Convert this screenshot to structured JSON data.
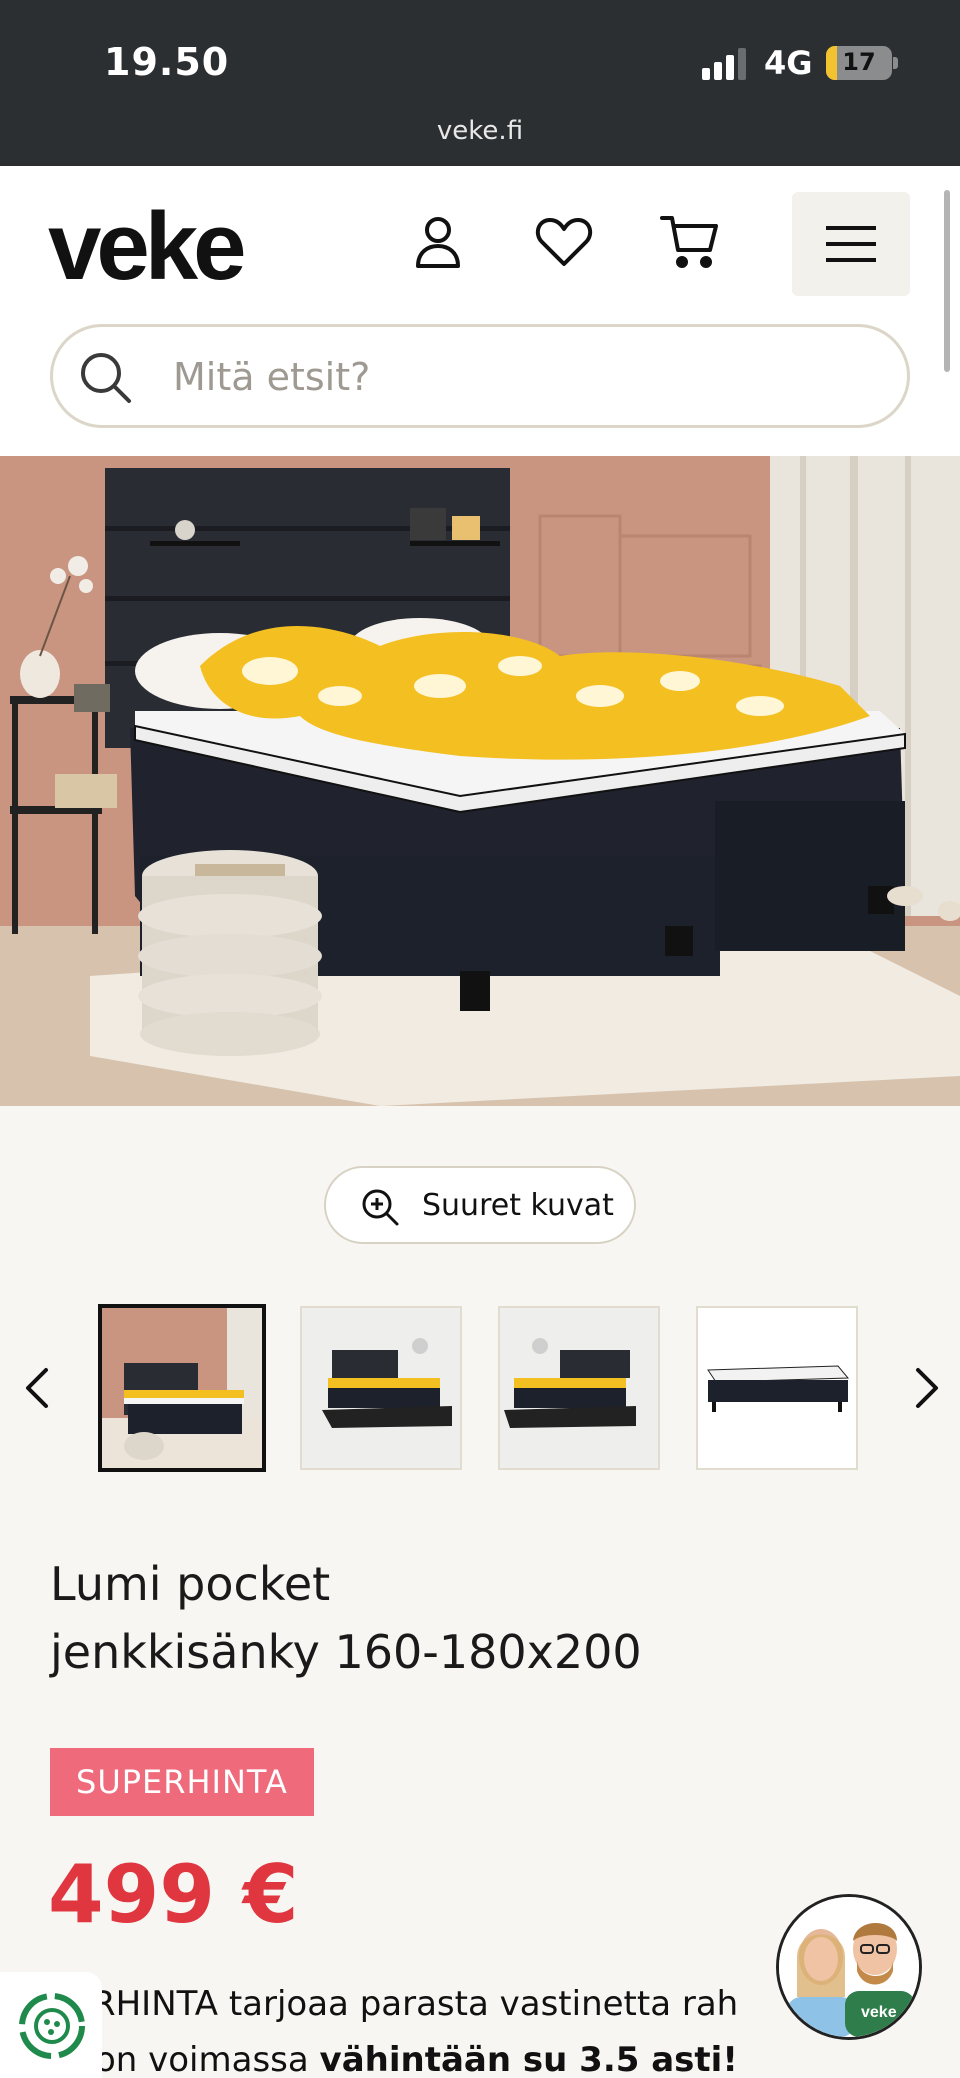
{
  "status_bar": {
    "time": "19.50",
    "network": "4G",
    "battery_level": "17",
    "battery_fraction": 0.17,
    "url": "veke.fi"
  },
  "header": {
    "logo": "veke",
    "icons": [
      "user-icon",
      "heart-icon",
      "cart-icon",
      "menu-icon"
    ],
    "search_placeholder": "Mitä etsit?"
  },
  "gallery": {
    "zoom_label": "Suuret kuvat",
    "thumbnails": [
      "thumb-lifestyle-pink",
      "thumb-lifestyle-white-1",
      "thumb-lifestyle-white-2",
      "thumb-product-only"
    ],
    "active_index": 0
  },
  "product": {
    "title_line1": "Lumi pocket",
    "title_line2": "jenkkisänky 160-180x200",
    "badge": "SUPERHINTA",
    "price": "499 €",
    "promo_line1_partial": "PERHINTA tarjoaa parasta vastinetta rah",
    "promo_line2_prefix": "ta on voimassa ",
    "promo_line2_bold": "vähintään su 3.5 asti!"
  },
  "colors": {
    "accent_red": "#e0363f",
    "badge_pink": "#ef6a7a",
    "status_bar_bg": "#2c2f32",
    "page_bg": "#f8f6f3"
  }
}
